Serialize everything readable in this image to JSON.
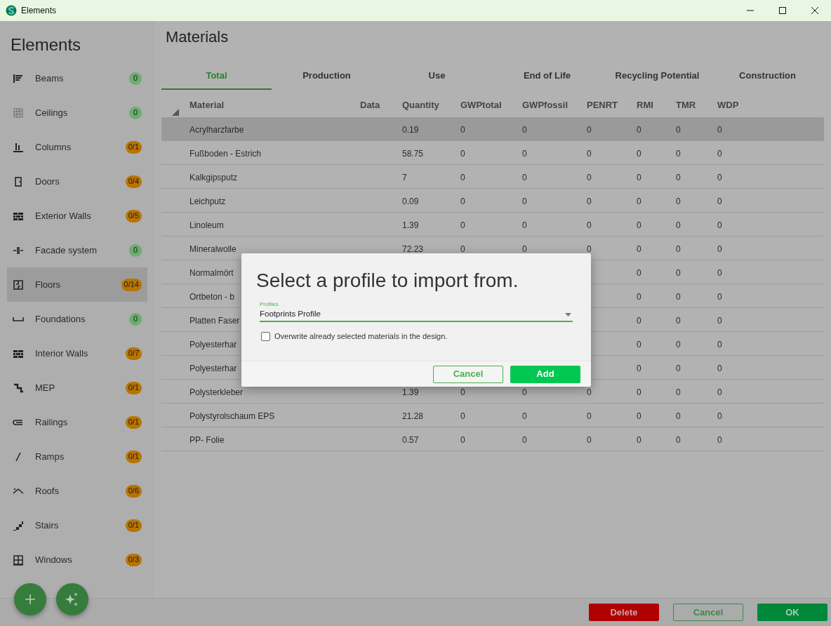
{
  "window": {
    "title": "Elements"
  },
  "sidebar": {
    "title": "Elements",
    "items": [
      {
        "label": "Beams",
        "badge": "0",
        "color": "#6aae6e",
        "selected": false
      },
      {
        "label": "Ceilings",
        "badge": "0",
        "color": "#6aae6e",
        "selected": false
      },
      {
        "label": "Columns",
        "badge": "0/1",
        "color": "#b97400",
        "selected": false
      },
      {
        "label": "Doors",
        "badge": "0/4",
        "color": "#b97400",
        "selected": false
      },
      {
        "label": "Exterior Walls",
        "badge": "0/5",
        "color": "#b97400",
        "selected": false
      },
      {
        "label": "Facade system",
        "badge": "0",
        "color": "#6aae6e",
        "selected": false
      },
      {
        "label": "Floors",
        "badge": "0/14",
        "color": "#b97400",
        "selected": true
      },
      {
        "label": "Foundations",
        "badge": "0",
        "color": "#6aae6e",
        "selected": false
      },
      {
        "label": "Interior Walls",
        "badge": "0/7",
        "color": "#b97400",
        "selected": false
      },
      {
        "label": "MEP",
        "badge": "0/1",
        "color": "#b97400",
        "selected": false
      },
      {
        "label": "Railings",
        "badge": "0/1",
        "color": "#b97400",
        "selected": false
      },
      {
        "label": "Ramps",
        "badge": "0/1",
        "color": "#b97400",
        "selected": false
      },
      {
        "label": "Roofs",
        "badge": "0/6",
        "color": "#b97400",
        "selected": false
      },
      {
        "label": "Stairs",
        "badge": "0/1",
        "color": "#b97400",
        "selected": false
      },
      {
        "label": "Windows",
        "badge": "0/3",
        "color": "#b97400",
        "selected": false
      }
    ]
  },
  "main": {
    "title": "Materials",
    "tabs": [
      {
        "label": "Total",
        "selected": true
      },
      {
        "label": "Production",
        "selected": false
      },
      {
        "label": "Use",
        "selected": false
      },
      {
        "label": "End of Life",
        "selected": false
      },
      {
        "label": "Recycling Potential",
        "selected": false
      },
      {
        "label": "Construction",
        "selected": false
      }
    ],
    "table": {
      "columns": [
        "Material",
        "Data",
        "Quantity",
        "GWPtotal",
        "GWPfossil",
        "PENRT",
        "RMI",
        "TMR",
        "WDP"
      ],
      "rows": [
        {
          "selected": true,
          "cells": {
            "Material": "Acrylharzfarbe",
            "Quantity": "0.19",
            "GWPtotal": "0",
            "GWPfossil": "0",
            "PENRT": "0",
            "RMI": "0",
            "TMR": "0",
            "WDP": "0"
          }
        },
        {
          "selected": false,
          "cells": {
            "Material": "Fußboden - Estrich",
            "Quantity": "58.75",
            "GWPtotal": "0",
            "GWPfossil": "0",
            "PENRT": "0",
            "RMI": "0",
            "TMR": "0",
            "WDP": "0"
          }
        },
        {
          "selected": false,
          "cells": {
            "Material": "Kalkgipsputz",
            "Quantity": "7",
            "GWPtotal": "0",
            "GWPfossil": "0",
            "PENRT": "0",
            "RMI": "0",
            "TMR": "0",
            "WDP": "0"
          }
        },
        {
          "selected": false,
          "cells": {
            "Material": "Leichputz",
            "Quantity": "0.09",
            "GWPtotal": "0",
            "GWPfossil": "0",
            "PENRT": "0",
            "RMI": "0",
            "TMR": "0",
            "WDP": "0"
          }
        },
        {
          "selected": false,
          "cells": {
            "Material": "Linoleum",
            "Quantity": "1.39",
            "GWPtotal": "0",
            "GWPfossil": "0",
            "PENRT": "0",
            "RMI": "0",
            "TMR": "0",
            "WDP": "0"
          }
        },
        {
          "selected": false,
          "cells": {
            "Material": "Mineralwolle",
            "Quantity": "72.23",
            "GWPtotal": "0",
            "GWPfossil": "0",
            "PENRT": "0",
            "RMI": "0",
            "TMR": "0",
            "WDP": "0"
          }
        },
        {
          "selected": false,
          "cells": {
            "Material": "Normalmört",
            "RMI": "0",
            "TMR": "0",
            "WDP": "0"
          }
        },
        {
          "selected": false,
          "cells": {
            "Material": "Ortbeton - b",
            "RMI": "0",
            "TMR": "0",
            "WDP": "0"
          }
        },
        {
          "selected": false,
          "cells": {
            "Material": "Platten Faser",
            "RMI": "0",
            "TMR": "0",
            "WDP": "0"
          }
        },
        {
          "selected": false,
          "cells": {
            "Material": "Polyesterhar",
            "RMI": "0",
            "TMR": "0",
            "WDP": "0"
          }
        },
        {
          "selected": false,
          "cells": {
            "Material": "Polyesterhar",
            "RMI": "0",
            "TMR": "0",
            "WDP": "0"
          }
        },
        {
          "selected": false,
          "cells": {
            "Material": "Polysterkleber",
            "Quantity": "1.39",
            "GWPtotal": "0",
            "GWPfossil": "0",
            "PENRT": "0",
            "RMI": "0",
            "TMR": "0",
            "WDP": "0"
          }
        },
        {
          "selected": false,
          "cells": {
            "Material": "Polystyrolschaum EPS",
            "Quantity": "21.28",
            "GWPtotal": "0",
            "GWPfossil": "0",
            "PENRT": "0",
            "RMI": "0",
            "TMR": "0",
            "WDP": "0"
          }
        },
        {
          "selected": false,
          "cells": {
            "Material": "PP- Folie",
            "Quantity": "0.57",
            "GWPtotal": "0",
            "GWPfossil": "0",
            "PENRT": "0",
            "RMI": "0",
            "TMR": "0",
            "WDP": "0"
          }
        }
      ]
    }
  },
  "footer": {
    "buttons": [
      {
        "label": "Delete",
        "kind": "danger"
      },
      {
        "label": "Cancel",
        "kind": "outline"
      },
      {
        "label": "OK",
        "kind": "primary"
      }
    ]
  },
  "dialog": {
    "title": "Select a profile to import from.",
    "field": {
      "label": "Profiles",
      "value": "Footprints Profile"
    },
    "checkbox": {
      "label": "Overwrite already selected materials in the design.",
      "checked": false
    },
    "buttons": [
      {
        "label": "Cancel",
        "kind": "outline"
      },
      {
        "label": "Add",
        "kind": "primary"
      }
    ]
  }
}
